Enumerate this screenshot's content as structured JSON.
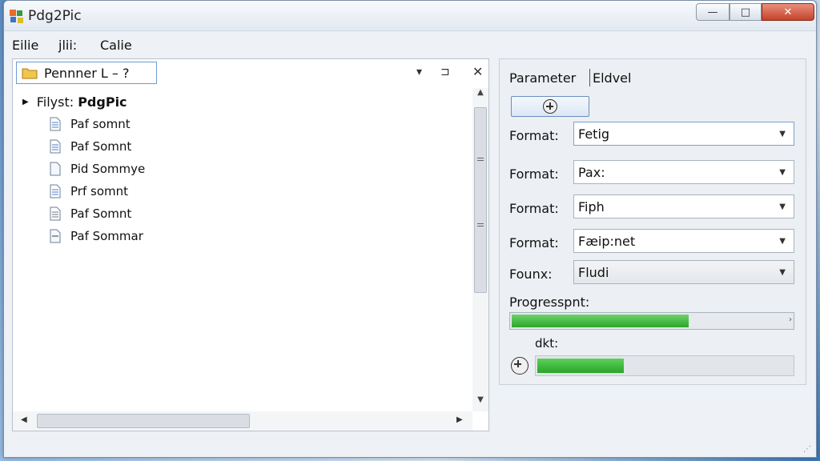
{
  "window": {
    "title": "Pdg2Pic",
    "min_glyph": "—",
    "max_glyph": "□",
    "close_glyph": "✕"
  },
  "menu": [
    {
      "label": "Eilie"
    },
    {
      "label": "jlii:"
    },
    {
      "label": "Calie"
    }
  ],
  "left_panel": {
    "location_text": "Pennner L  –  ?",
    "dropdown_glyph": "▾",
    "pin_glyph": "⊐",
    "close_glyph": "✕",
    "tree_root_prefix": "Filyst:",
    "tree_root_name": "PdgPic",
    "items": [
      {
        "label": "Paf somnt"
      },
      {
        "label": "Paf Somnt"
      },
      {
        "label": "Pid Sommye"
      },
      {
        "label": "Prf somnt"
      },
      {
        "label": "Paf Somnt"
      },
      {
        "label": "Paf Sommar"
      }
    ]
  },
  "right_panel": {
    "tab_parameter": "Parameter",
    "tab_eldvel": "Eldvel",
    "rows": [
      {
        "label": "Format:",
        "value": "Fetig"
      },
      {
        "label": "Format:",
        "value": "Pax:"
      },
      {
        "label": "Format:",
        "value": "Fiph"
      },
      {
        "label": "Format:",
        "value": "Fæip:net"
      },
      {
        "label": "Founx:",
        "value": "Fludi"
      }
    ],
    "progress_label": "Progresspnt:",
    "progress_value": 0.63,
    "sub_label": "dkt:",
    "sub_progress_value": 0.34
  },
  "colors": {
    "accent": "#6d9bd1",
    "progress_green": "#2aa62a",
    "close_red": "#c4422a"
  }
}
